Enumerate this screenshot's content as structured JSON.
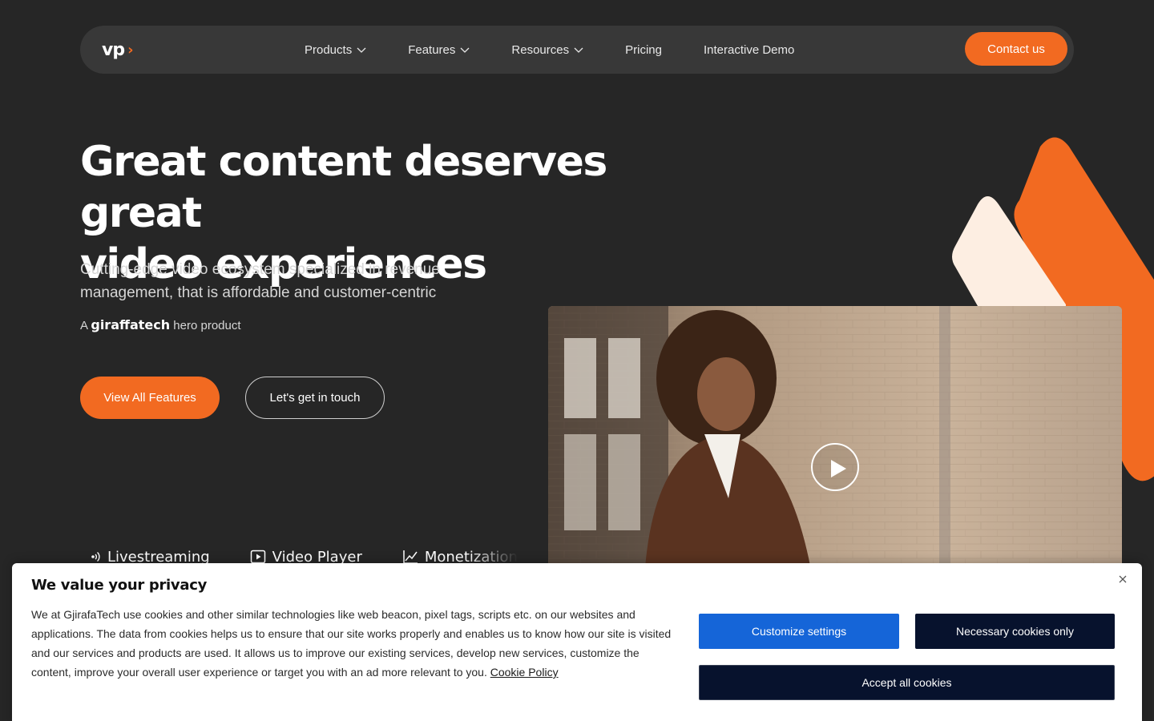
{
  "brand": {
    "logo_text": "vp",
    "accent_glyph": "›",
    "accent_color": "#f26a21"
  },
  "nav": {
    "items": [
      {
        "label": "Products",
        "dropdown": true
      },
      {
        "label": "Features",
        "dropdown": true
      },
      {
        "label": "Resources",
        "dropdown": true
      },
      {
        "label": "Pricing",
        "dropdown": false
      },
      {
        "label": "Interactive Demo",
        "dropdown": false
      }
    ],
    "contact_label": "Contact us"
  },
  "hero": {
    "title_line1": "Great content deserves great",
    "title_line2": "video experiences",
    "subtitle": "Cutting-edge video ecosystem specialized in revenue management, that is affordable and customer-centric",
    "brand_prefix": "A",
    "brand_name": "giraffatech",
    "brand_suffix": "hero product",
    "primary_cta": "View All Features",
    "secondary_cta": "Let's get in touch"
  },
  "features": [
    {
      "label": "Livestreaming",
      "icon": "broadcast-icon"
    },
    {
      "label": "Video Player",
      "icon": "play-square-icon"
    },
    {
      "label": "Monetization",
      "icon": "line-chart-icon"
    }
  ],
  "cookie": {
    "title": "We value your privacy",
    "text": "We at GjirafaTech use cookies and other similar technologies like web beacon, pixel tags, scripts etc. on our websites and applications. The data from cookies helps us to ensure that our site works properly and enables us to know how our site is visited and our services and products are used. It allows us to improve our existing services, develop new services, customize the content, improve your overall user experience or target you with an ad more relevant to you.",
    "policy_link": "Cookie Policy",
    "customize_label": "Customize settings",
    "necessary_label": "Necessary cookies only",
    "accept_label": "Accept all cookies"
  },
  "colors": {
    "background": "#262626",
    "nav_bg": "#383838",
    "accent": "#f26a21",
    "cream": "#fdeee2",
    "customize_blue": "#1565d8",
    "navy": "#07122d"
  }
}
